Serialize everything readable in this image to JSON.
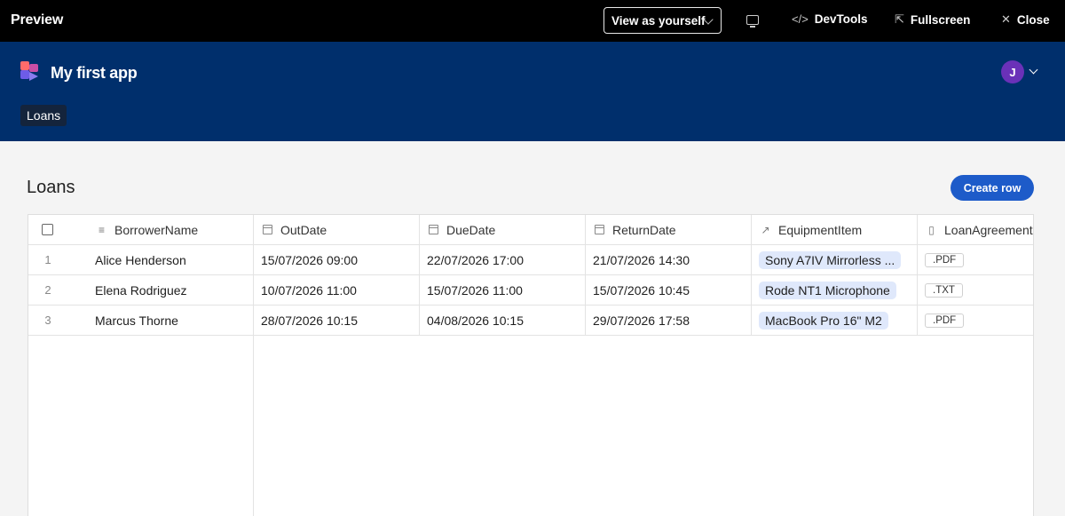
{
  "preview_bar": {
    "title": "Preview",
    "view_as": "View as yourself",
    "devtools": "DevTools",
    "fullscreen": "Fullscreen",
    "close": "Close",
    "icons": {
      "devtools": "code-icon",
      "fullscreen": "external-link-icon",
      "close": "close-icon",
      "device": "monitor-icon"
    }
  },
  "app": {
    "title": "My first app",
    "avatar_initial": "J",
    "nav": [
      "Loans"
    ]
  },
  "page": {
    "title": "Loans",
    "create_button": "Create row"
  },
  "table": {
    "columns": [
      {
        "label": "BorrowerName",
        "icon": "text-icon"
      },
      {
        "label": "OutDate",
        "icon": "calendar-icon"
      },
      {
        "label": "DueDate",
        "icon": "calendar-icon"
      },
      {
        "label": "ReturnDate",
        "icon": "calendar-icon"
      },
      {
        "label": "EquipmentItem",
        "icon": "link-icon"
      },
      {
        "label": "LoanAgreement",
        "icon": "file-icon"
      }
    ],
    "rows": [
      {
        "num": "1",
        "borrower": "Alice Henderson",
        "out": "15/07/2026 09:00",
        "due": "22/07/2026 17:00",
        "ret": "21/07/2026 14:30",
        "equipment": "Sony A7IV Mirrorless ...",
        "file": ".PDF"
      },
      {
        "num": "2",
        "borrower": "Elena Rodriguez",
        "out": "10/07/2026 11:00",
        "due": "15/07/2026 11:00",
        "ret": "15/07/2026 10:45",
        "equipment": "Rode NT1 Microphone",
        "file": ".TXT"
      },
      {
        "num": "3",
        "borrower": "Marcus Thorne",
        "out": "28/07/2026 10:15",
        "due": "04/08/2026 10:15",
        "ret": "29/07/2026 17:58",
        "equipment": "MacBook Pro 16\" M2",
        "file": ".PDF"
      }
    ]
  },
  "colors": {
    "topbar": "#000000",
    "header": "#002f6c",
    "accent_button": "#1d5bc9",
    "avatar": "#6a31b8",
    "tag_bg": "#dfe8fb"
  }
}
